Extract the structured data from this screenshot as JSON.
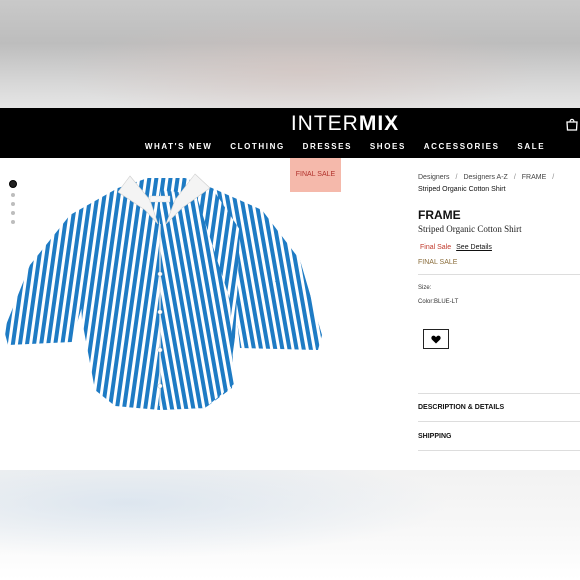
{
  "header": {
    "logo_light": "INTER",
    "logo_bold": "MIX",
    "nav": [
      "WHAT'S NEW",
      "CLOTHING",
      "DRESSES",
      "SHOES",
      "ACCESSORIES",
      "SALE"
    ]
  },
  "badge": {
    "label": "FINAL SALE"
  },
  "gallery": {
    "dot_count": 5,
    "active_index": 0
  },
  "breadcrumb": {
    "items": [
      "Designers",
      "Designers A-Z",
      "FRAME"
    ],
    "current": "Striped Organic Cotton Shirt"
  },
  "product": {
    "brand": "FRAME",
    "name": "Striped Organic Cotton Shirt",
    "price_label": "Final Sale",
    "see_details": "See Details",
    "final_sale_note": "FINAL SALE",
    "size_label": "Size:",
    "color_label": "Color:BLUE-LT"
  },
  "accordion": {
    "description": "DESCRIPTION & DETAILS",
    "shipping": "SHIPPING"
  },
  "colors": {
    "header_bg": "#000000",
    "badge_bg": "#f5b9ab",
    "stripe_blue": "#1e7bc4",
    "sale_red": "#c0392b"
  },
  "icons": {
    "bag": "shopping-bag-icon",
    "wishlist": "heart-icon"
  }
}
